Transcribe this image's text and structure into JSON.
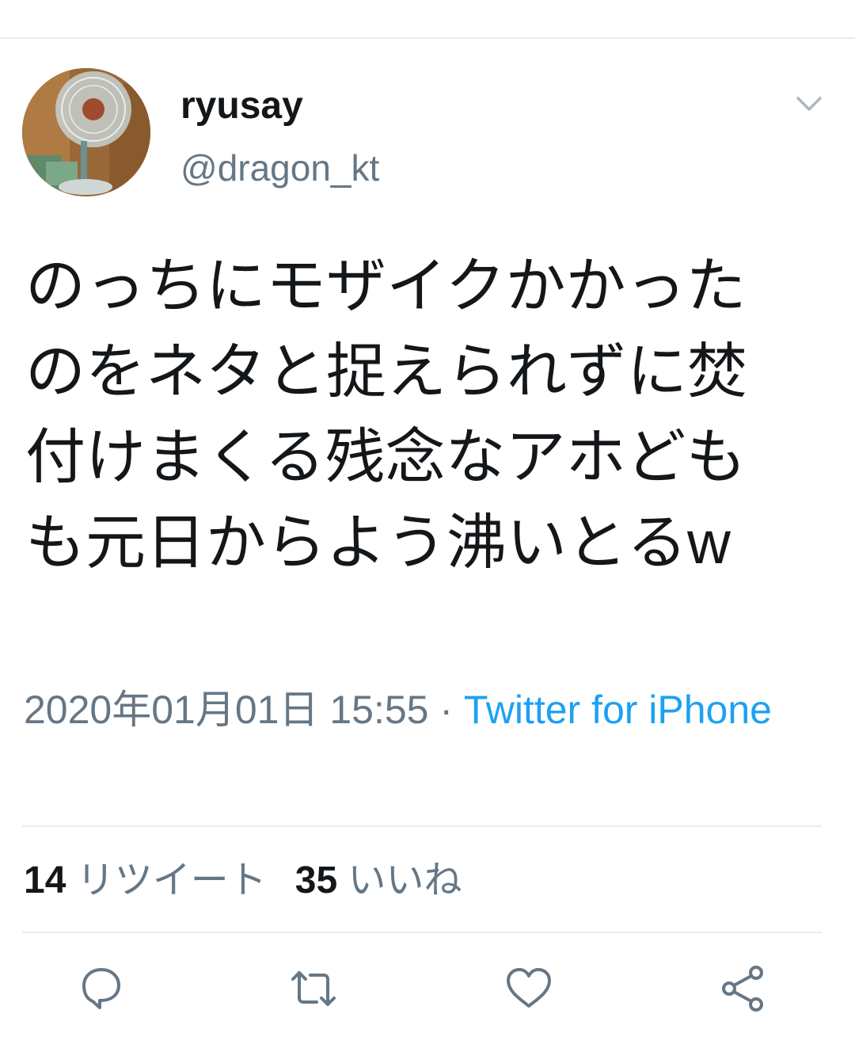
{
  "tweet": {
    "user_name": "ryusay",
    "user_handle": "@dragon_kt",
    "text": "のっちにモザイクかかったのをネタと捉えられずに焚付けまくる残念なアホどもも元日からよう沸いとるw",
    "timestamp": "2020年01月01日 15:55",
    "separator": " · ",
    "source": "Twitter for iPhone"
  },
  "stats": {
    "retweets": {
      "count": "14",
      "label": "リツイート"
    },
    "likes": {
      "count": "35",
      "label": "いいね"
    }
  },
  "actions": {
    "reply_icon": "reply-icon",
    "retweet_icon": "retweet-icon",
    "like_icon": "heart-icon",
    "share_icon": "share-icon"
  },
  "colors": {
    "accent": "#1da1f2",
    "secondary_text": "#657786",
    "primary_text": "#14171a",
    "divider": "#e6ecf0"
  }
}
